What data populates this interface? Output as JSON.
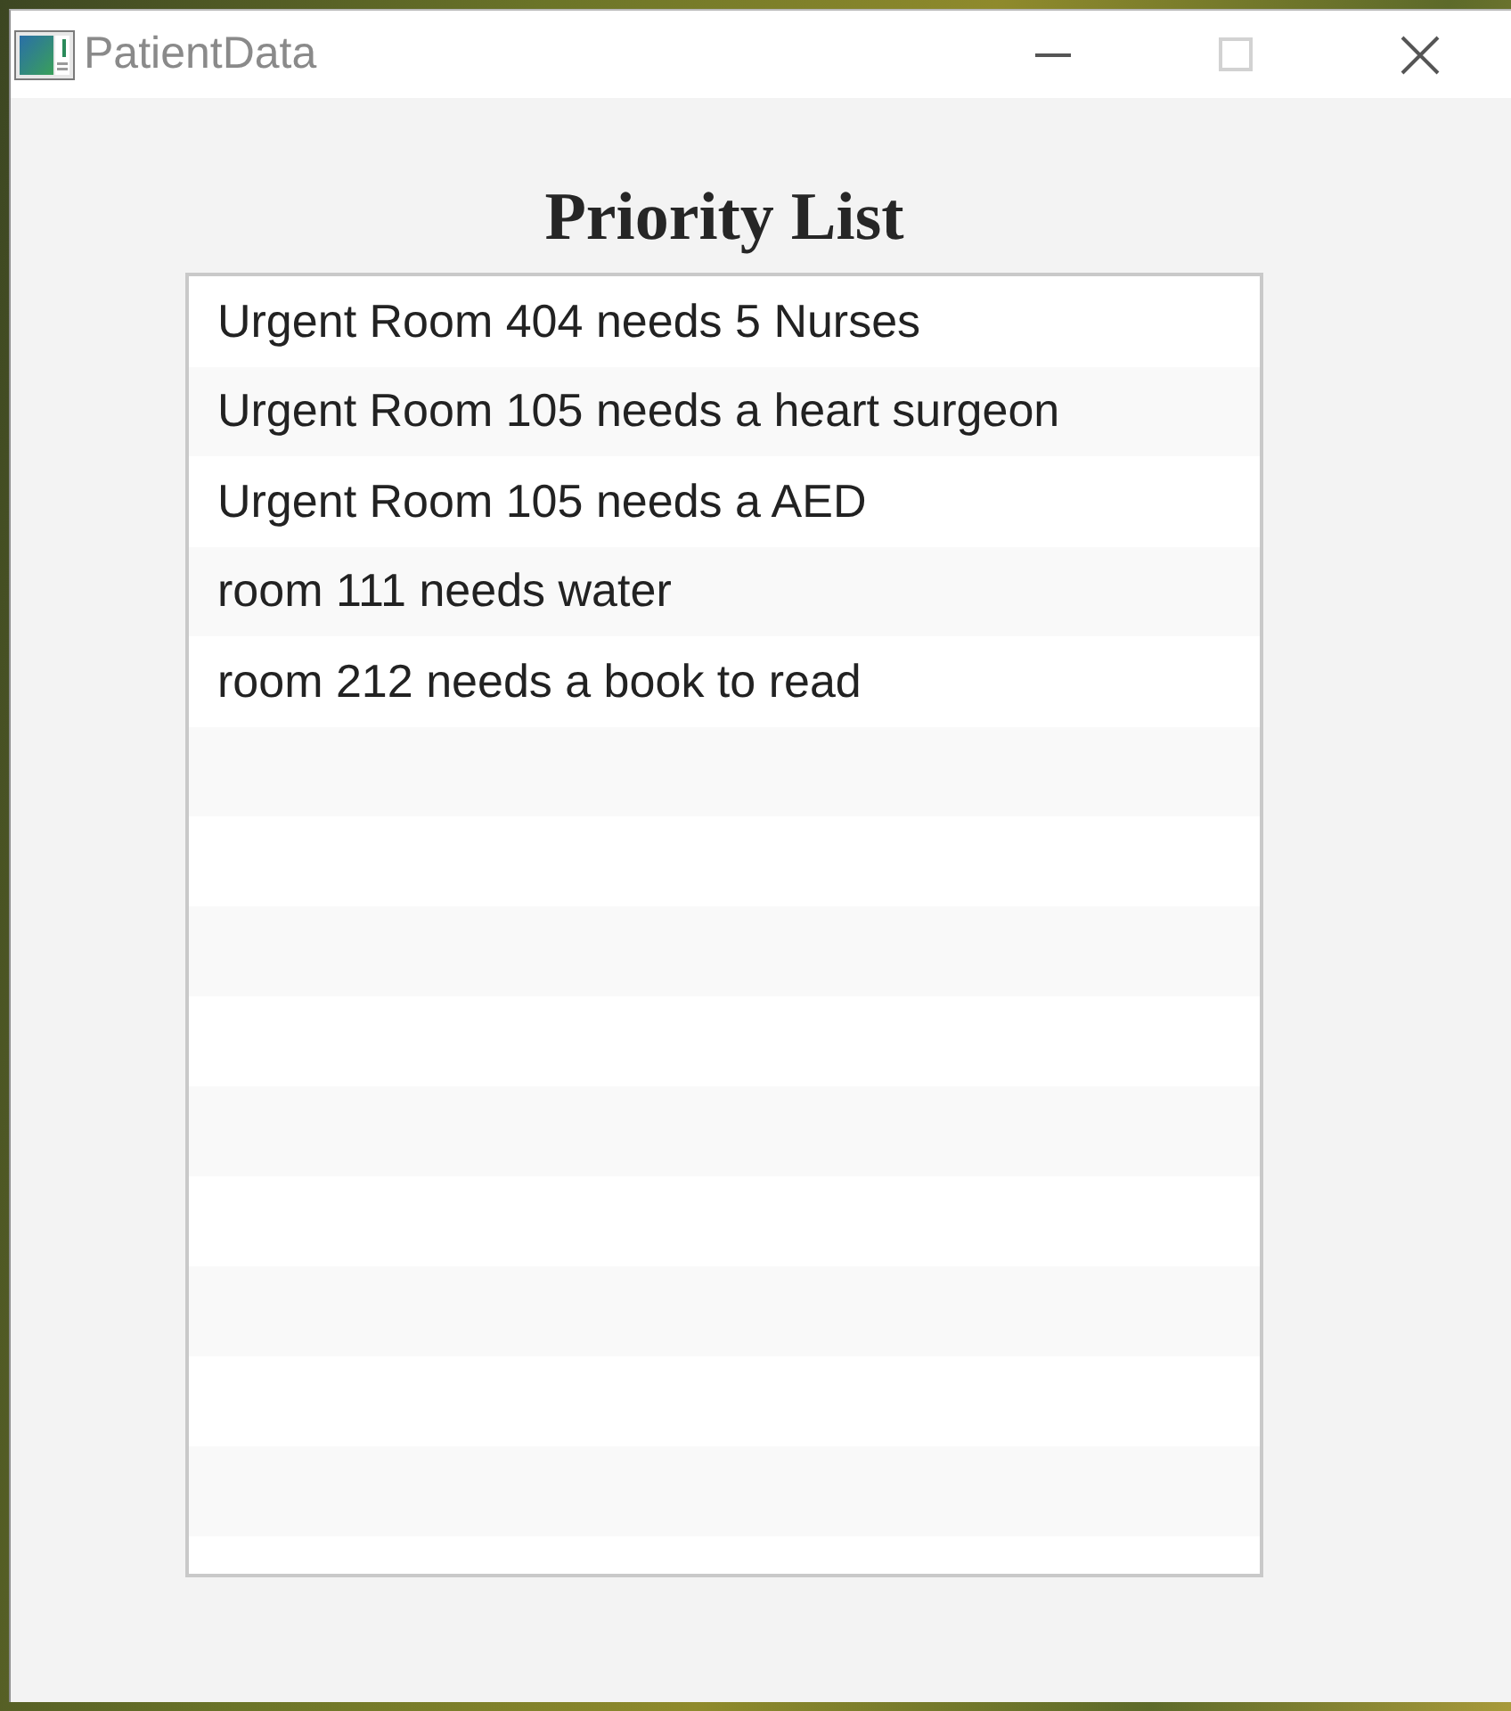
{
  "window": {
    "title": "PatientData",
    "caption_buttons": [
      {
        "kind": "minimize",
        "disabled": false
      },
      {
        "kind": "maximize",
        "disabled": true
      },
      {
        "kind": "close",
        "disabled": false
      }
    ]
  },
  "heading": "Priority List",
  "priority_list": {
    "items": [
      {
        "text": "Urgent Room 404 needs 5 Nurses",
        "selected": false
      },
      {
        "text": "Urgent Room 105 needs a heart surgeon",
        "selected": false
      },
      {
        "text": "Urgent Room 105 needs a AED",
        "selected": false
      },
      {
        "text": "room 111 needs water",
        "selected": false
      },
      {
        "text": "room 212 needs a book to read",
        "selected": false
      }
    ]
  }
}
